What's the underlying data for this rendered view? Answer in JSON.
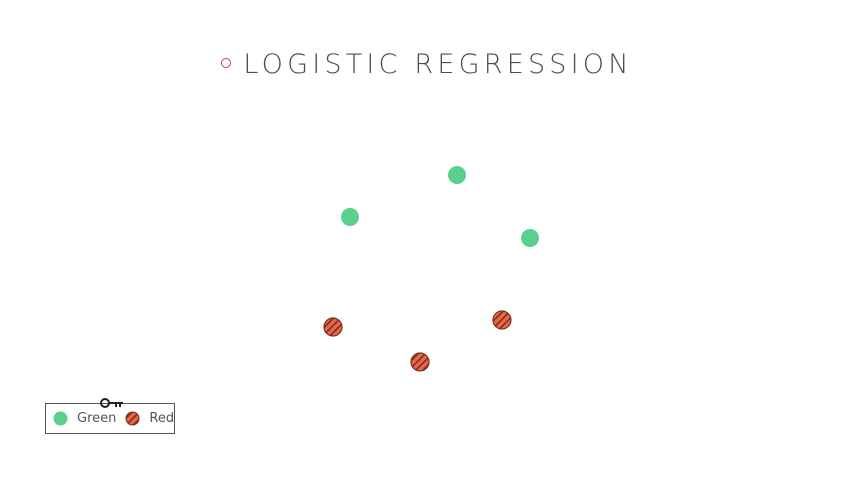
{
  "title": "LOGISTIC REGRESSION",
  "colors": {
    "title_marker": "#b5485a",
    "green": "#5bd08c",
    "red": "#e8694a",
    "red_stripe": "#7a2f22"
  },
  "legend": {
    "key_icon": "key-icon",
    "items": [
      {
        "label": "Green",
        "class": "green"
      },
      {
        "label": "Red",
        "class": "red"
      }
    ]
  },
  "chart_data": {
    "type": "scatter",
    "series": [
      {
        "name": "Green",
        "points": [
          [
            350,
            217
          ],
          [
            457,
            175
          ],
          [
            530,
            238
          ]
        ]
      },
      {
        "name": "Red",
        "points": [
          [
            333,
            327
          ],
          [
            420,
            362
          ],
          [
            502,
            320
          ]
        ]
      }
    ]
  }
}
